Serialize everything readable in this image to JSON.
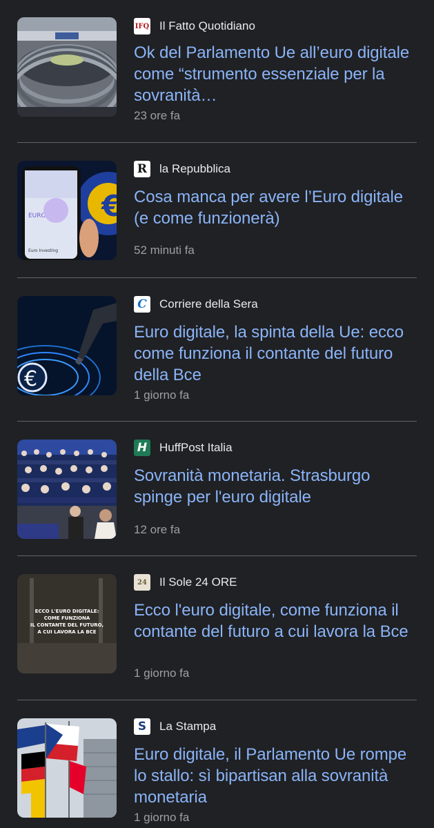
{
  "articles": [
    {
      "source": "Il Fatto Quotidiano",
      "logo_text": "IFQ",
      "headline": "Ok del Parlamento Ue all’euro digitale come “strumento essenziale per la sovranità…",
      "time": "23 ore fa"
    },
    {
      "source": "la Repubblica",
      "logo_text": "R",
      "headline": "Cosa manca per avere l’Euro digitale (e come funzionerà)",
      "time": "52 minuti fa",
      "thumb_text": {
        "line1": "EURO",
        "line2": "Euro Investing"
      }
    },
    {
      "source": "Corriere della Sera",
      "logo_text": "C",
      "headline": "Euro digitale, la spinta della Ue: ecco come funziona il contante del futuro della Bce",
      "time": "1 giorno fa",
      "thumb_text": {
        "symbol": "€"
      }
    },
    {
      "source": "HuffPost Italia",
      "logo_text": "H",
      "headline": "Sovranità monetaria. Strasburgo spinge per l'euro digitale",
      "time": "12 ore fa"
    },
    {
      "source": "Il Sole 24 ORE",
      "logo_text": "24",
      "headline": "Ecco l'euro digitale, come funziona il contante del futuro a cui lavora la Bce",
      "time": "1 giorno fa",
      "thumb_text": {
        "line1": "ECCO L'EURO DIGITALE:",
        "line2": "COME FUNZIONA",
        "line3": "IL CONTANTE DEL FUTURO,",
        "line4": "A CUI LAVORA LA BCE"
      }
    },
    {
      "source": "La Stampa",
      "logo_text": "S",
      "headline": "Euro digitale, il Parlamento Ue rompe lo stallo: sì bipartisan alla sovranità monetaria",
      "time": "1 giorno fa"
    }
  ],
  "colors": {
    "background": "#202124",
    "headline": "#8ab4f8",
    "source": "#e8eaed",
    "time": "#9aa0a6",
    "divider": "#5f6368"
  }
}
